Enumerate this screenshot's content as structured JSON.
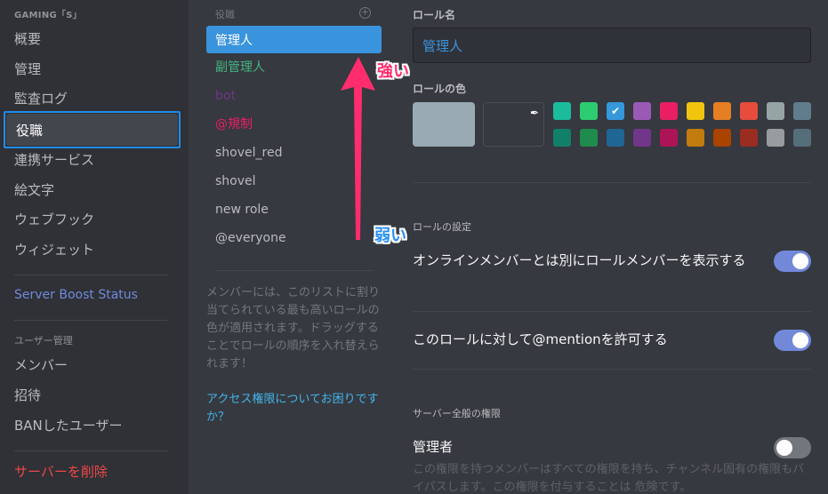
{
  "sidebar": {
    "server_name": "GAMING「S」",
    "items": [
      {
        "label": "概要"
      },
      {
        "label": "管理"
      },
      {
        "label": "監査ログ"
      },
      {
        "label": "役職",
        "active": true
      },
      {
        "label": "連携サービス"
      },
      {
        "label": "絵文字"
      },
      {
        "label": "ウェブフック"
      },
      {
        "label": "ウィジェット"
      }
    ],
    "boost_label": "Server Boost Status",
    "user_mgmt_header": "ユーザー管理",
    "user_items": [
      {
        "label": "メンバー"
      },
      {
        "label": "招待"
      },
      {
        "label": "BANしたユーザー"
      }
    ],
    "delete_label": "サーバーを削除"
  },
  "roles": {
    "header": "役職",
    "add_icon": "plus-circle-icon",
    "items": [
      {
        "label": "管理人",
        "color": "#ffffff",
        "selected": true
      },
      {
        "label": "副管理人",
        "color": "#43b581"
      },
      {
        "label": "bot",
        "color": "#71368a"
      },
      {
        "label": "@規制",
        "color": "#e91e63"
      },
      {
        "label": "shovel_red",
        "color": "#b9bbbe"
      },
      {
        "label": "shovel",
        "color": "#b9bbbe"
      },
      {
        "label": "new role",
        "color": "#b9bbbe"
      },
      {
        "label": "@everyone",
        "color": "#b9bbbe"
      }
    ],
    "help_text": "メンバーには、このリストに割り当てられている最も高いロールの色が適用されます。ドラッグすることでロールの順序を入れ替えられます！",
    "help_link": "アクセス権限についてお困りですか？"
  },
  "annotation": {
    "strong": "強い",
    "weak": "弱い",
    "arrow_color": "#ff2d6e"
  },
  "main": {
    "role_name_label": "ロール名",
    "role_name_value": "管理人",
    "role_color_label": "ロールの色",
    "default_color": "#99aab5",
    "swatches_top": [
      "#1abc9c",
      "#2ecc71",
      "#3498db",
      "#9b59b6",
      "#e91e63",
      "#f1c40f",
      "#e67e22",
      "#e74c3c",
      "#95a5a6",
      "#607d8b"
    ],
    "swatches_bottom": [
      "#11806a",
      "#1f8b4c",
      "#206694",
      "#71368a",
      "#ad1457",
      "#c27c0e",
      "#a84300",
      "#992d22",
      "#979c9f",
      "#546e7a"
    ],
    "selected_swatch": 2,
    "settings_label": "ロールの設定",
    "setting_hoist": "オンラインメンバーとは別にロールメンバーを表示する",
    "setting_hoist_on": true,
    "setting_mention": "このロールに対して@mentionを許可する",
    "setting_mention_on": true,
    "perm_header": "サーバー全般の権限",
    "perm_admin": "管理者",
    "perm_admin_on": false,
    "perm_admin_desc": "この権限を持つメンバーはすべての権限を持ち、チャンネル固有の権限もバイパスします。この権限を付与することは 危険です。"
  }
}
